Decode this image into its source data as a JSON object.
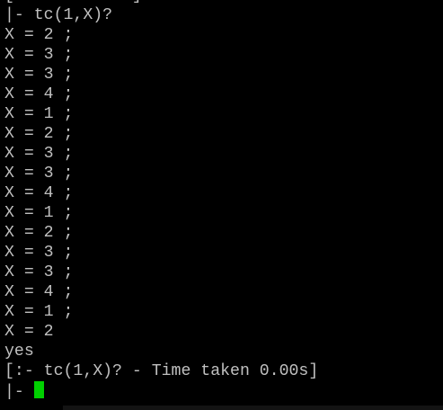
{
  "terminal": {
    "colors": {
      "background": "#000000",
      "text": "#c0c0c0",
      "cursor": "#00d000"
    },
    "lines": [
      "[:-          ]",
      "|- tc(1,X)?",
      "X = 2 ;",
      "X = 3 ;",
      "X = 3 ;",
      "X = 4 ;",
      "X = 1 ;",
      "X = 2 ;",
      "X = 3 ;",
      "X = 3 ;",
      "X = 4 ;",
      "X = 1 ;",
      "X = 2 ;",
      "X = 3 ;",
      "X = 3 ;",
      "X = 4 ;",
      "X = 1 ;",
      "X = 2",
      "yes",
      "[:- tc(1,X)? - Time taken 0.00s]"
    ],
    "prompt": "|- "
  }
}
